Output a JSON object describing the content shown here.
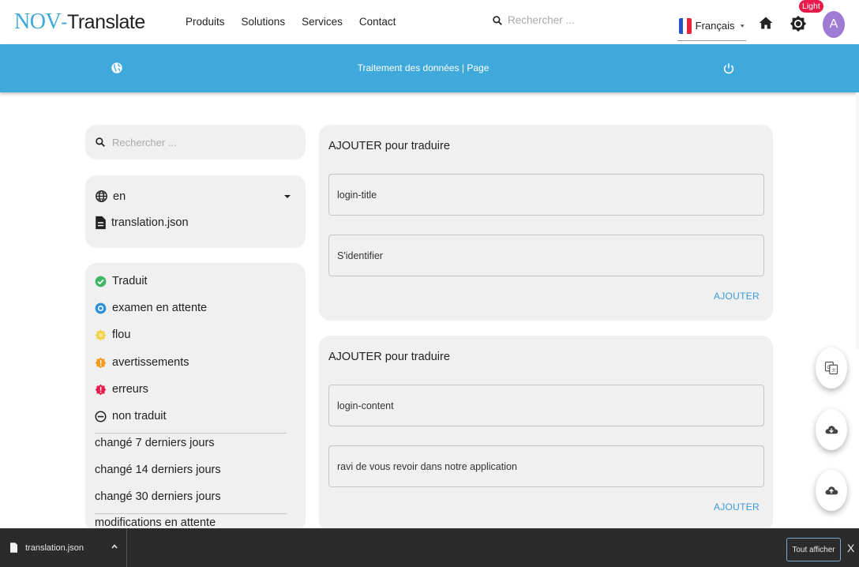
{
  "app": {
    "logo_part1": "NOV",
    "logo_part2": "-",
    "logo_part3": "Translate"
  },
  "nav": {
    "items": [
      "Produits",
      "Solutions",
      "Services",
      "Contact"
    ],
    "search_placeholder": "Rechercher ...",
    "language": "Français",
    "theme_badge": "Light",
    "avatar_letter": "A"
  },
  "banner": {
    "title": "Traitement des données | Page"
  },
  "sidebar": {
    "search_placeholder": "Rechercher ...",
    "language_code": "en",
    "file_name": "translation.json",
    "filters": [
      {
        "label": "Traduit",
        "icon": "check-circle-icon",
        "color": "#3fb566"
      },
      {
        "label": "examen en attente",
        "icon": "pending-review-icon",
        "color": "#2d8fd9"
      },
      {
        "label": "flou",
        "icon": "fuzzy-badge-icon",
        "color": "#f1d24a"
      },
      {
        "label": "avertissements",
        "icon": "warning-badge-icon",
        "color": "#f19a1c"
      },
      {
        "label": "erreurs",
        "icon": "error-badge-icon",
        "color": "#e8194b"
      },
      {
        "label": "non traduit",
        "icon": "minus-circle-icon",
        "color": "#222222"
      }
    ],
    "changes": [
      "changé 7 derniers jours",
      "changé 14 derniers jours",
      "changé 30 derniers jours"
    ],
    "pending": "modifications en attente"
  },
  "cards": [
    {
      "title": "AJOUTER pour traduire",
      "key": "login-title",
      "value": "S'identifier",
      "button": "AJOUTER"
    },
    {
      "title": "AJOUTER pour traduire",
      "key": "login-content",
      "value": "ravi de vous revoir dans notre application",
      "button": "AJOUTER"
    }
  ],
  "fabs": [
    "google-translate-icon",
    "cloud-download-icon",
    "cloud-upload-icon"
  ],
  "downloads": {
    "file": "translation.json",
    "show_all": "Tout afficher",
    "close": "X"
  },
  "colors": {
    "accent": "#3fa9dc",
    "link": "#3a9ad9",
    "badge": "#e8194b",
    "avatar": "#9f7bd6"
  }
}
